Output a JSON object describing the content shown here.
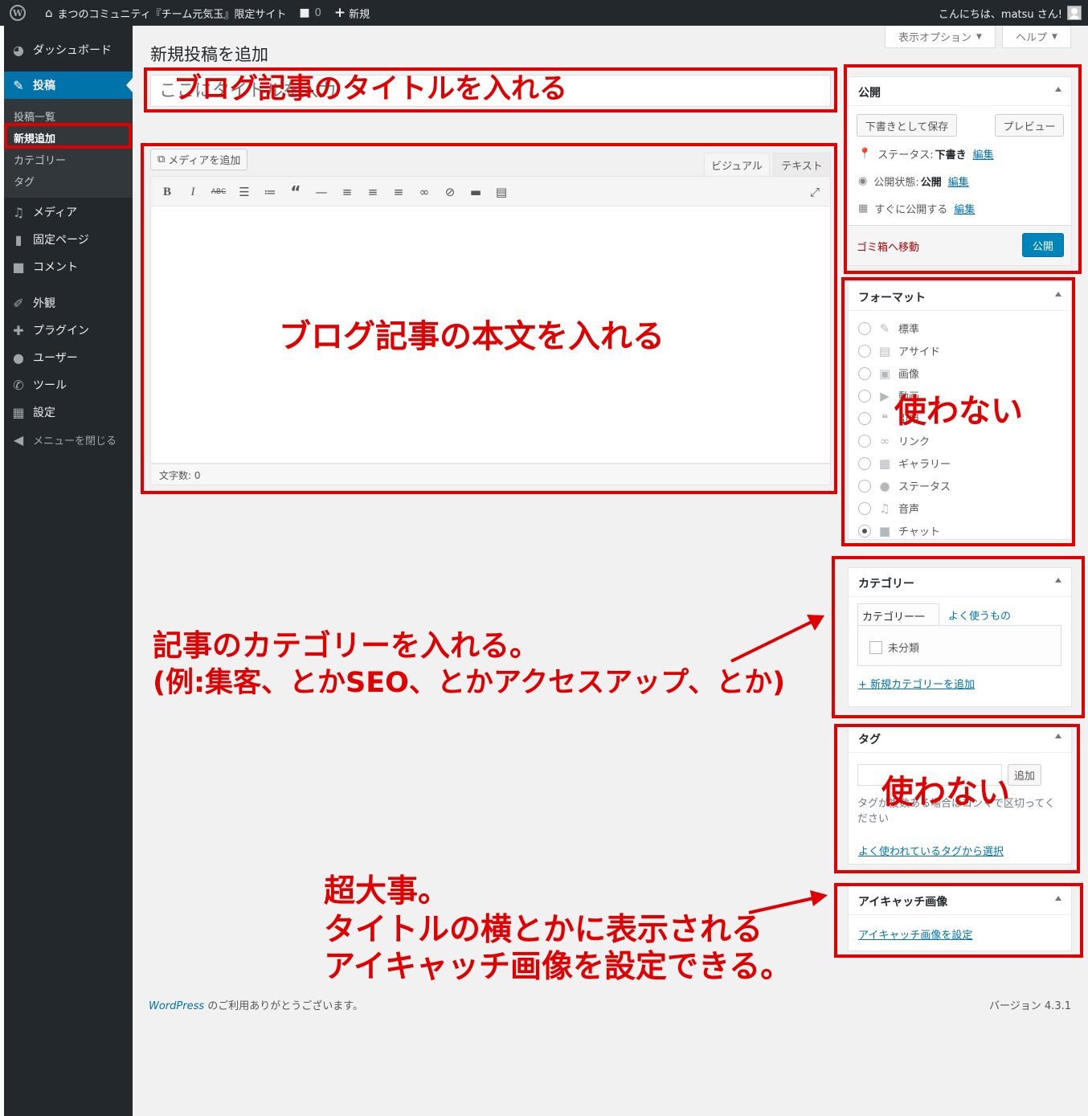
{
  "adminbar": {
    "site_name": "まつのコミュニティ『チーム元気玉』限定サイト",
    "comments_count": "0",
    "new_label": "新規",
    "greeting": "こんにちは、matsu さん!"
  },
  "menu": {
    "items": [
      {
        "label": "ダッシュボード",
        "icon": "dashboard-icon"
      },
      {
        "label": "投稿",
        "icon": "pin-icon"
      },
      {
        "label": "メディア",
        "icon": "media-icon"
      },
      {
        "label": "固定ページ",
        "icon": "page-icon"
      },
      {
        "label": "コメント",
        "icon": "comment-icon"
      },
      {
        "label": "外観",
        "icon": "brush-icon"
      },
      {
        "label": "プラグイン",
        "icon": "plugin-icon"
      },
      {
        "label": "ユーザー",
        "icon": "user-icon"
      },
      {
        "label": "ツール",
        "icon": "wrench-icon"
      },
      {
        "label": "設定",
        "icon": "settings-icon"
      },
      {
        "label": "メニューを閉じる",
        "icon": "collapse-icon"
      }
    ],
    "submenu": [
      "投稿一覧",
      "新規追加",
      "カテゴリー",
      "タグ"
    ]
  },
  "screen": {
    "title": "新規投稿を追加",
    "options_label": "表示オプション",
    "help_label": "ヘルプ"
  },
  "title_field": {
    "placeholder": "ここにタイトルを入力"
  },
  "editor": {
    "media_button": "メディアを追加",
    "tab_visual": "ビジュアル",
    "tab_text": "テキスト",
    "word_count": "文字数: 0"
  },
  "publish_box": {
    "title": "公開",
    "save_draft": "下書きとして保存",
    "preview": "プレビュー",
    "status_label": "ステータス:",
    "status_value": "下書き",
    "visibility_label": "公開状態:",
    "visibility_value": "公開",
    "schedule_label": "すぐに公開する",
    "edit_link": "編集",
    "trash": "ゴミ箱へ移動",
    "publish": "公開"
  },
  "format_box": {
    "title": "フォーマット",
    "options": [
      {
        "label": "標準",
        "icon": "pin-icon",
        "checked": false
      },
      {
        "label": "アサイド",
        "icon": "aside-icon",
        "checked": false
      },
      {
        "label": "画像",
        "icon": "image-icon",
        "checked": false
      },
      {
        "label": "動画",
        "icon": "video-icon",
        "checked": false
      },
      {
        "label": "引用",
        "icon": "quote-icon",
        "checked": false
      },
      {
        "label": "リンク",
        "icon": "link-icon",
        "checked": false
      },
      {
        "label": "ギャラリー",
        "icon": "gallery-icon",
        "checked": false
      },
      {
        "label": "ステータス",
        "icon": "status-icon",
        "checked": false
      },
      {
        "label": "音声",
        "icon": "audio-icon",
        "checked": false
      },
      {
        "label": "チャット",
        "icon": "chat-icon",
        "checked": true
      }
    ]
  },
  "category_box": {
    "title": "カテゴリー",
    "tab_all": "カテゴリー一覧",
    "tab_popular": "よく使うもの",
    "items": [
      "未分類"
    ],
    "add_new": "+ 新規カテゴリーを追加"
  },
  "tag_box": {
    "title": "タグ",
    "add_button": "追加",
    "help_text": "タグが複数ある場合はコンマで区切ってください",
    "choose_link": "よく使われているタグから選択"
  },
  "thumbnail_box": {
    "title": "アイキャッチ画像",
    "set_link": "アイキャッチ画像を設定"
  },
  "footer": {
    "wp_link": "WordPress",
    "thanks": " のご利用ありがとうございます。",
    "version": "バージョン 4.3.1"
  },
  "annotations": {
    "title_note": "ブログ記事のタイトルを入れる",
    "body_note": "ブログ記事の本文を入れる",
    "format_note": "使わない",
    "tag_note": "使わない",
    "category_note_line1": "記事のカテゴリーを入れる。",
    "category_note_line2": "(例:集客、とかSEO、とかアクセスアップ、とか)",
    "thumb_note_line1": "超大事。",
    "thumb_note_line2": "タイトルの横とかに表示される",
    "thumb_note_line3": "アイキャッチ画像を設定できる。",
    "color": "#e00000"
  }
}
